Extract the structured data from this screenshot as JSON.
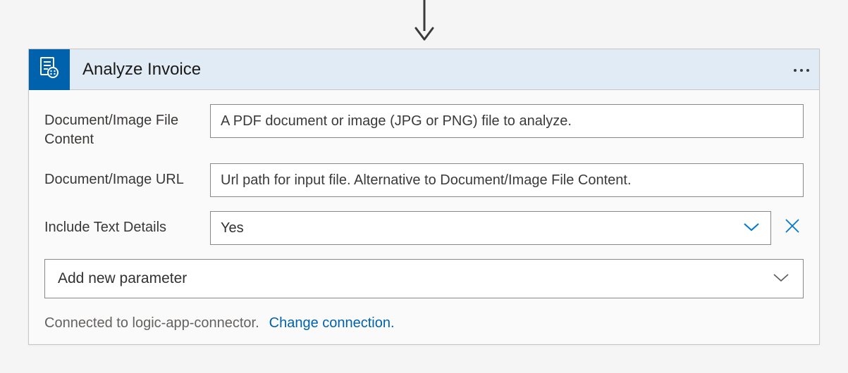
{
  "header": {
    "title": "Analyze Invoice"
  },
  "fields": {
    "file_content": {
      "label": "Document/Image File Content",
      "placeholder": "A PDF document or image (JPG or PNG) file to analyze."
    },
    "url": {
      "label": "Document/Image URL",
      "placeholder": "Url path for input file. Alternative to Document/Image File Content."
    },
    "include_text": {
      "label": "Include Text Details",
      "value": "Yes"
    }
  },
  "add_param_label": "Add new parameter",
  "footer": {
    "connected_text": "Connected to logic-app-connector.",
    "change_link": "Change connection."
  }
}
